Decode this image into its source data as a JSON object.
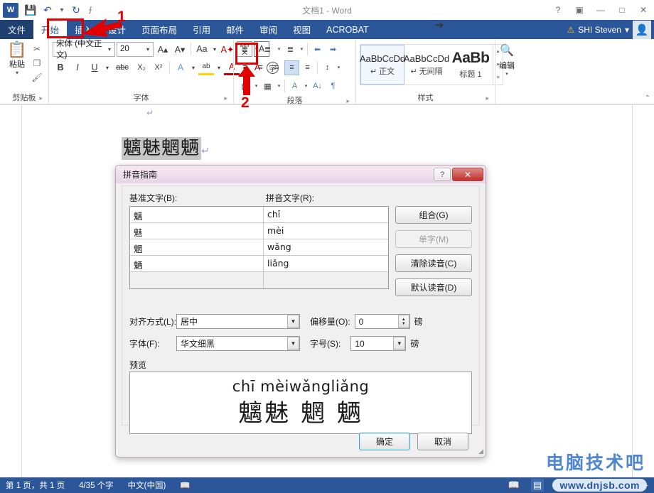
{
  "app": {
    "title": "文档1 - Word",
    "quick_access": [
      {
        "name": "word-logo",
        "glyph": "W"
      },
      {
        "name": "save-icon",
        "glyph": "💾"
      },
      {
        "name": "undo-icon",
        "glyph": "↶"
      },
      {
        "name": "undo-dropdown-icon",
        "glyph": "▾"
      },
      {
        "name": "redo-icon",
        "glyph": "↻"
      },
      {
        "name": "customize-qat-icon",
        "glyph": "⨍"
      }
    ],
    "window_buttons": [
      {
        "name": "help-button",
        "glyph": "?"
      },
      {
        "name": "ribbon-display-options-button",
        "glyph": "▣"
      },
      {
        "name": "minimize-button",
        "glyph": "—"
      },
      {
        "name": "maximize-button",
        "glyph": "□"
      },
      {
        "name": "close-button",
        "glyph": "✕"
      }
    ],
    "account": {
      "name": "SHI Steven",
      "caret": "▾",
      "warning": "⚠"
    }
  },
  "tabs": [
    {
      "label": "文件",
      "state": "file"
    },
    {
      "label": "开始",
      "state": "active"
    },
    {
      "label": "插入",
      "state": "normal"
    },
    {
      "label": "设计",
      "state": "normal"
    },
    {
      "label": "页面布局",
      "state": "normal"
    },
    {
      "label": "引用",
      "state": "normal"
    },
    {
      "label": "邮件",
      "state": "normal"
    },
    {
      "label": "审阅",
      "state": "normal"
    },
    {
      "label": "视图",
      "state": "normal"
    },
    {
      "label": "ACROBAT",
      "state": "normal"
    }
  ],
  "ribbon": {
    "clipboard": {
      "label": "剪贴板",
      "paste_label": "粘贴",
      "paste_caret": "▾",
      "side_icons": [
        {
          "name": "cut-icon",
          "glyph": "✂"
        },
        {
          "name": "copy-icon",
          "glyph": "❐"
        },
        {
          "name": "format-painter-icon",
          "glyph": "🖌"
        }
      ],
      "dialog_launcher": "⯈"
    },
    "font": {
      "label": "字体",
      "font_name": "宋体 (中文正文)",
      "font_size": "20",
      "row1": [
        {
          "name": "grow-font-icon",
          "glyph": "A▴"
        },
        {
          "name": "shrink-font-icon",
          "glyph": "A▾"
        },
        {
          "name": "change-case-icon",
          "glyph": "Aa"
        },
        {
          "name": "change-case-caret",
          "glyph": "▾"
        },
        {
          "name": "clear-formatting-icon",
          "glyph": "A✦"
        },
        {
          "name": "phonetic-guide-icon",
          "glyph_top": "wén",
          "glyph_bottom": "文"
        },
        {
          "name": "character-border-icon",
          "glyph": "A"
        }
      ],
      "row2": [
        {
          "name": "bold-icon",
          "glyph": "B"
        },
        {
          "name": "italic-icon",
          "glyph": "I"
        },
        {
          "name": "underline-icon",
          "glyph": "U"
        },
        {
          "name": "underline-caret",
          "glyph": "▾"
        },
        {
          "name": "strikethrough-icon",
          "glyph": "abc"
        },
        {
          "name": "subscript-icon",
          "glyph": "X₂"
        },
        {
          "name": "superscript-icon",
          "glyph": "X²"
        },
        {
          "name": "text-effects-icon",
          "glyph": "A"
        },
        {
          "name": "text-effects-caret",
          "glyph": "▾"
        },
        {
          "name": "highlight-color-icon",
          "glyph": "ab"
        },
        {
          "name": "highlight-caret",
          "glyph": "▾"
        },
        {
          "name": "font-color-icon",
          "glyph": "A"
        },
        {
          "name": "font-color-caret",
          "glyph": "▾"
        },
        {
          "name": "character-shading-icon",
          "glyph": "A"
        },
        {
          "name": "enclose-character-icon",
          "glyph": "字"
        }
      ],
      "dialog_launcher": "⯈"
    },
    "paragraph": {
      "label": "段落",
      "row1": [
        {
          "name": "bullets-icon",
          "glyph": "≣"
        },
        {
          "name": "bullets-caret",
          "glyph": "▾"
        },
        {
          "name": "numbering-icon",
          "glyph": "≣"
        },
        {
          "name": "numbering-caret",
          "glyph": "▾"
        },
        {
          "name": "multilevel-list-icon",
          "glyph": "≣"
        },
        {
          "name": "multilevel-caret",
          "glyph": "▾"
        },
        {
          "name": "decrease-indent-icon",
          "glyph": "⬅"
        },
        {
          "name": "increase-indent-icon",
          "glyph": "➡"
        }
      ],
      "row2": [
        {
          "name": "align-left-icon",
          "glyph": "≡"
        },
        {
          "name": "align-center-icon",
          "glyph": "≡"
        },
        {
          "name": "align-right-icon",
          "glyph": "≡"
        },
        {
          "name": "justify-icon",
          "glyph": "≡"
        },
        {
          "name": "distributed-icon",
          "glyph": "≡"
        },
        {
          "name": "line-spacing-icon",
          "glyph": "↕"
        },
        {
          "name": "line-spacing-caret",
          "glyph": "▾"
        }
      ],
      "row3": [
        {
          "name": "shading-icon",
          "glyph": "▧"
        },
        {
          "name": "shading-caret",
          "glyph": "▾"
        },
        {
          "name": "borders-icon",
          "glyph": "▦"
        },
        {
          "name": "borders-caret",
          "glyph": "▾"
        },
        {
          "name": "asian-layout-icon",
          "glyph": "A"
        },
        {
          "name": "asian-layout-caret",
          "glyph": "▾"
        },
        {
          "name": "sort-icon",
          "glyph": "A↓"
        },
        {
          "name": "show-marks-icon",
          "glyph": "¶"
        }
      ],
      "dialog_launcher": "⯈"
    },
    "styles": {
      "label": "样式",
      "items": [
        {
          "sample": "AaBbCcDd",
          "name": "↵ 正文",
          "selected": true
        },
        {
          "sample": "AaBbCcDd",
          "name": "↵ 无间隔",
          "selected": false
        },
        {
          "sample": "AaBb",
          "name": "标题 1",
          "selected": false
        }
      ],
      "scroll": [
        "▴",
        "▾",
        "≡"
      ],
      "dialog_launcher": "⯈"
    },
    "editing": {
      "label": "编辑",
      "icon": "⌕",
      "caret": "▾"
    },
    "collapse_icon": "⌃"
  },
  "document": {
    "text": "魑魅魍魉",
    "paragraph_mark": "↵"
  },
  "annotations": [
    {
      "name": "annotation-1",
      "label": "1"
    },
    {
      "name": "annotation-2",
      "label": "2"
    }
  ],
  "dialog": {
    "title": "拼音指南",
    "help_glyph": "?",
    "close_glyph": "✕",
    "column_headers": {
      "base": "基准文字(B):",
      "pinyin": "拼音文字(R):"
    },
    "rows": [
      {
        "base": "魑",
        "pinyin": "chī"
      },
      {
        "base": "魅",
        "pinyin": "mèi"
      },
      {
        "base": "魍",
        "pinyin": "wǎng"
      },
      {
        "base": "魉",
        "pinyin": "liǎng"
      },
      {
        "base": "",
        "pinyin": ""
      }
    ],
    "side_buttons": [
      {
        "label": "组合(G)",
        "name": "combine-button",
        "disabled": false
      },
      {
        "label": "单字(M)",
        "name": "single-char-button",
        "disabled": true
      },
      {
        "label": "清除读音(C)",
        "name": "clear-reading-button",
        "disabled": false
      },
      {
        "label": "默认读音(D)",
        "name": "default-reading-button",
        "disabled": false
      }
    ],
    "options": {
      "alignment_label": "对齐方式(L):",
      "alignment_value": "居中",
      "offset_label": "偏移量(O):",
      "offset_value": "0",
      "offset_unit": "磅",
      "font_label": "字体(F):",
      "font_value": "华文细黑",
      "size_label": "字号(S):",
      "size_value": "10",
      "size_unit": "磅",
      "caret": "▼"
    },
    "preview_label": "预览",
    "preview": {
      "pinyin": "chī mèiwǎngliǎng",
      "hanzi": "魑魅 魍 魉"
    },
    "ok_label": "确定",
    "cancel_label": "取消"
  },
  "status_bar": {
    "page": "第 1 页，共 1 页",
    "words": "4/35 个字",
    "language": "中文(中国)",
    "proofing_icon": "📖",
    "views": [
      {
        "name": "read-mode-view",
        "glyph": "📖",
        "active": false
      },
      {
        "name": "print-layout-view",
        "glyph": "▤",
        "active": true
      },
      {
        "name": "web-layout-view",
        "glyph": "🌐",
        "active": false
      }
    ],
    "zoom_minus": "-"
  },
  "watermarks": {
    "brand": "电脑技术吧",
    "url": "www.dnjsb.com"
  },
  "colors": {
    "word_blue": "#2b579a",
    "annotation_red": "#e00000",
    "dialog_pink": "#e8d5e6"
  }
}
